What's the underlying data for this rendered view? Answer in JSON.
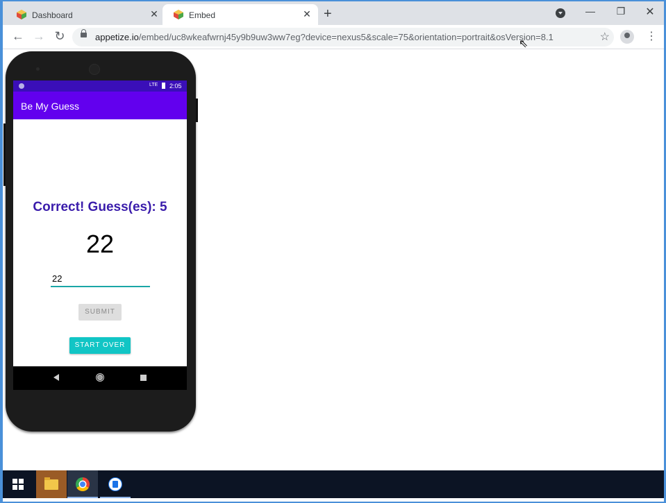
{
  "browser": {
    "tabs": [
      {
        "label": "Dashboard",
        "active": false
      },
      {
        "label": "Embed",
        "active": true
      }
    ],
    "new_tab_symbol": "+",
    "url_host": "appetize.io",
    "url_path": "/embed/uc8wkeafwrnj45y9b9uw3ww7eg?device=nexus5&scale=75&orientation=portrait&osVersion=8.1"
  },
  "phone": {
    "status_time": "2:05",
    "network_label": "LTE",
    "app_title": "Be My Guess",
    "result_text": "Correct! Guess(es): 5",
    "number": "22",
    "input_value": "22",
    "submit_label": "SUBMIT",
    "start_over_label": "START OVER"
  },
  "colors": {
    "status_bar": "#3a0fb8",
    "app_bar": "#6200ee",
    "result_text": "#3a1cab",
    "accent": "#11c5c5"
  }
}
